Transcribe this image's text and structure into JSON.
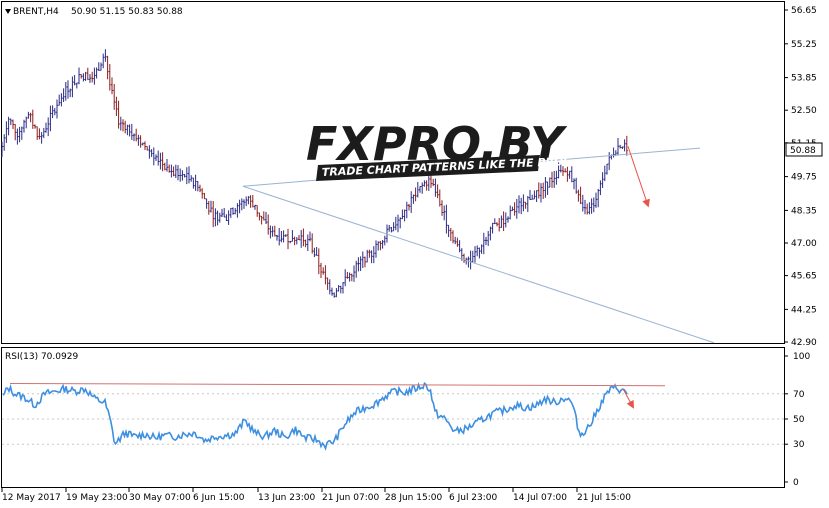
{
  "chart_data": [
    {
      "type": "ohlc",
      "title": "BRENT,H4",
      "header_values": "50.90 51.15 50.83 50.88",
      "current_price_label": "50.88",
      "current_price": 50.88,
      "ylim": [
        42.9,
        56.65
      ],
      "y_ticks": [
        "56.65",
        "55.25",
        "53.85",
        "52.50",
        "51.15",
        "49.75",
        "48.35",
        "47.00",
        "45.65",
        "44.25",
        "42.90"
      ],
      "x_ticks": [
        "12 May 2017",
        "19 May 23:00",
        "30 May 07:00",
        "6 Jun 15:00",
        "13 Jun 23:00",
        "21 Jun 07:00",
        "28 Jun 15:00",
        "6 Jul 23:00",
        "14 Jul 07:00",
        "21 Jul 15:00"
      ],
      "price_path": [
        [
          0,
          50.6
        ],
        [
          8,
          52.2
        ],
        [
          18,
          51.5
        ],
        [
          28,
          52.4
        ],
        [
          40,
          51.3
        ],
        [
          55,
          52.6
        ],
        [
          65,
          53.3
        ],
        [
          80,
          53.9
        ],
        [
          95,
          54.0
        ],
        [
          105,
          54.8
        ],
        [
          110,
          53.5
        ],
        [
          118,
          52.1
        ],
        [
          130,
          51.7
        ],
        [
          145,
          51.0
        ],
        [
          160,
          50.4
        ],
        [
          172,
          49.9
        ],
        [
          185,
          49.8
        ],
        [
          200,
          49.2
        ],
        [
          212,
          48.2
        ],
        [
          225,
          48.0
        ],
        [
          238,
          48.6
        ],
        [
          250,
          48.8
        ],
        [
          262,
          48.0
        ],
        [
          272,
          47.4
        ],
        [
          285,
          47.2
        ],
        [
          298,
          47.3
        ],
        [
          310,
          47.0
        ],
        [
          318,
          46.2
        ],
        [
          326,
          45.4
        ],
        [
          334,
          44.9
        ],
        [
          342,
          45.3
        ],
        [
          352,
          45.8
        ],
        [
          362,
          46.3
        ],
        [
          372,
          46.6
        ],
        [
          382,
          47.2
        ],
        [
          395,
          47.8
        ],
        [
          405,
          48.4
        ],
        [
          415,
          49.0
        ],
        [
          425,
          49.5
        ],
        [
          432,
          49.6
        ],
        [
          440,
          48.6
        ],
        [
          450,
          47.5
        ],
        [
          460,
          46.6
        ],
        [
          470,
          46.2
        ],
        [
          480,
          46.8
        ],
        [
          490,
          47.6
        ],
        [
          500,
          47.8
        ],
        [
          510,
          48.2
        ],
        [
          520,
          48.6
        ],
        [
          530,
          48.9
        ],
        [
          540,
          49.1
        ],
        [
          550,
          49.6
        ],
        [
          560,
          49.9
        ],
        [
          568,
          50.0
        ],
        [
          575,
          49.4
        ],
        [
          583,
          48.3
        ],
        [
          590,
          48.4
        ],
        [
          598,
          49.0
        ],
        [
          606,
          50.2
        ],
        [
          614,
          50.8
        ],
        [
          620,
          51.1
        ],
        [
          628,
          50.9
        ]
      ],
      "lines": [
        {
          "name": "upper-trendline",
          "from": [
            243,
            49.35
          ],
          "to": [
            700,
            50.93
          ],
          "color": "#9ab4d0"
        },
        {
          "name": "lower-trendline",
          "from": [
            243,
            49.35
          ],
          "to": [
            714,
            42.87
          ],
          "color": "#9ab4d0"
        },
        {
          "name": "forecast-arrow",
          "from": [
            628,
            51.0
          ],
          "to": [
            648,
            48.55
          ],
          "color": "#e8534a"
        }
      ],
      "colors": {
        "bar": "#2a2a86",
        "bar_accent": "#8b1c1c",
        "trendline": "#9ab4d0",
        "arrow": "#e8534a"
      }
    },
    {
      "type": "line",
      "title": "RSI(13) 70.0929",
      "ylim": [
        0,
        100
      ],
      "y_ticks": [
        "100",
        "70",
        "50",
        "30",
        "0"
      ],
      "levels": [
        70,
        50,
        30
      ],
      "rsi_path": [
        [
          0,
          63
        ],
        [
          8,
          75
        ],
        [
          15,
          70
        ],
        [
          25,
          67
        ],
        [
          35,
          61
        ],
        [
          45,
          70
        ],
        [
          55,
          72
        ],
        [
          65,
          74
        ],
        [
          75,
          72
        ],
        [
          85,
          74
        ],
        [
          95,
          66
        ],
        [
          105,
          63
        ],
        [
          110,
          50
        ],
        [
          115,
          30
        ],
        [
          125,
          39
        ],
        [
          135,
          36
        ],
        [
          145,
          38
        ],
        [
          155,
          35
        ],
        [
          165,
          37
        ],
        [
          175,
          36
        ],
        [
          185,
          38
        ],
        [
          195,
          39
        ],
        [
          205,
          33
        ],
        [
          215,
          36
        ],
        [
          225,
          37
        ],
        [
          235,
          38
        ],
        [
          245,
          49
        ],
        [
          255,
          39
        ],
        [
          265,
          36
        ],
        [
          275,
          41
        ],
        [
          285,
          35
        ],
        [
          295,
          42
        ],
        [
          305,
          35
        ],
        [
          315,
          34
        ],
        [
          325,
          29
        ],
        [
          335,
          33
        ],
        [
          345,
          46
        ],
        [
          355,
          55
        ],
        [
          365,
          59
        ],
        [
          375,
          62
        ],
        [
          385,
          68
        ],
        [
          395,
          72
        ],
        [
          405,
          71
        ],
        [
          415,
          74
        ],
        [
          425,
          77
        ],
        [
          430,
          74
        ],
        [
          435,
          55
        ],
        [
          445,
          50
        ],
        [
          455,
          40
        ],
        [
          465,
          42
        ],
        [
          475,
          46
        ],
        [
          485,
          51
        ],
        [
          495,
          55
        ],
        [
          505,
          57
        ],
        [
          515,
          61
        ],
        [
          525,
          59
        ],
        [
          535,
          60
        ],
        [
          545,
          66
        ],
        [
          555,
          63
        ],
        [
          565,
          67
        ],
        [
          572,
          63
        ],
        [
          580,
          37
        ],
        [
          590,
          45
        ],
        [
          600,
          61
        ],
        [
          608,
          72
        ],
        [
          616,
          75
        ],
        [
          628,
          70
        ]
      ],
      "lines": [
        {
          "name": "rsi-resistance",
          "from": [
            10,
            78.2
          ],
          "to": [
            665,
            76.4
          ],
          "color": "#d27272"
        },
        {
          "name": "rsi-arrow",
          "from": [
            623,
            74.0
          ],
          "to": [
            633,
            59.5
          ],
          "color": "#e8534a"
        }
      ],
      "colors": {
        "line": "#3d8fe0"
      }
    }
  ],
  "watermark": {
    "brand": "FXPRO.BY",
    "tagline": "TRADE CHART PATTERNS LIKE THE PROS"
  }
}
